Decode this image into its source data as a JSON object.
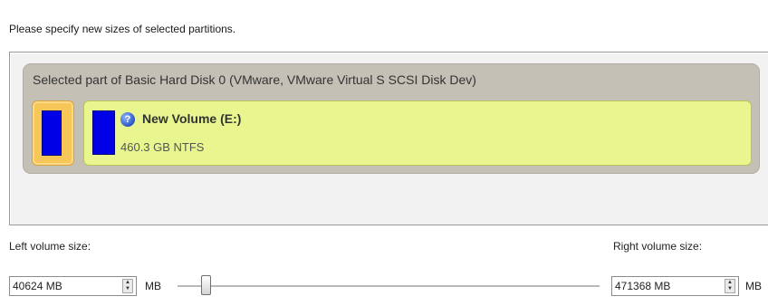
{
  "instruction": "Please specify new sizes of selected partitions.",
  "disk": {
    "title": "Selected part of Basic Hard Disk 0 (VMware, VMware Virtual S SCSI Disk Dev)"
  },
  "partition": {
    "name": "New Volume (E:)",
    "info": "460.3 GB NTFS",
    "icon": "question-icon"
  },
  "left": {
    "label": "Left volume size:",
    "value": "40624 MB",
    "unit": "MB"
  },
  "right": {
    "label": "Right volume size:",
    "value": "471368 MB",
    "unit": "MB"
  },
  "slider": {
    "value_fraction": 0.079
  },
  "colors": {
    "unallocated": "#f7c659",
    "partition": "#e9f68f",
    "bar": "#0000e6",
    "disk_group": "#c4c0b6"
  }
}
